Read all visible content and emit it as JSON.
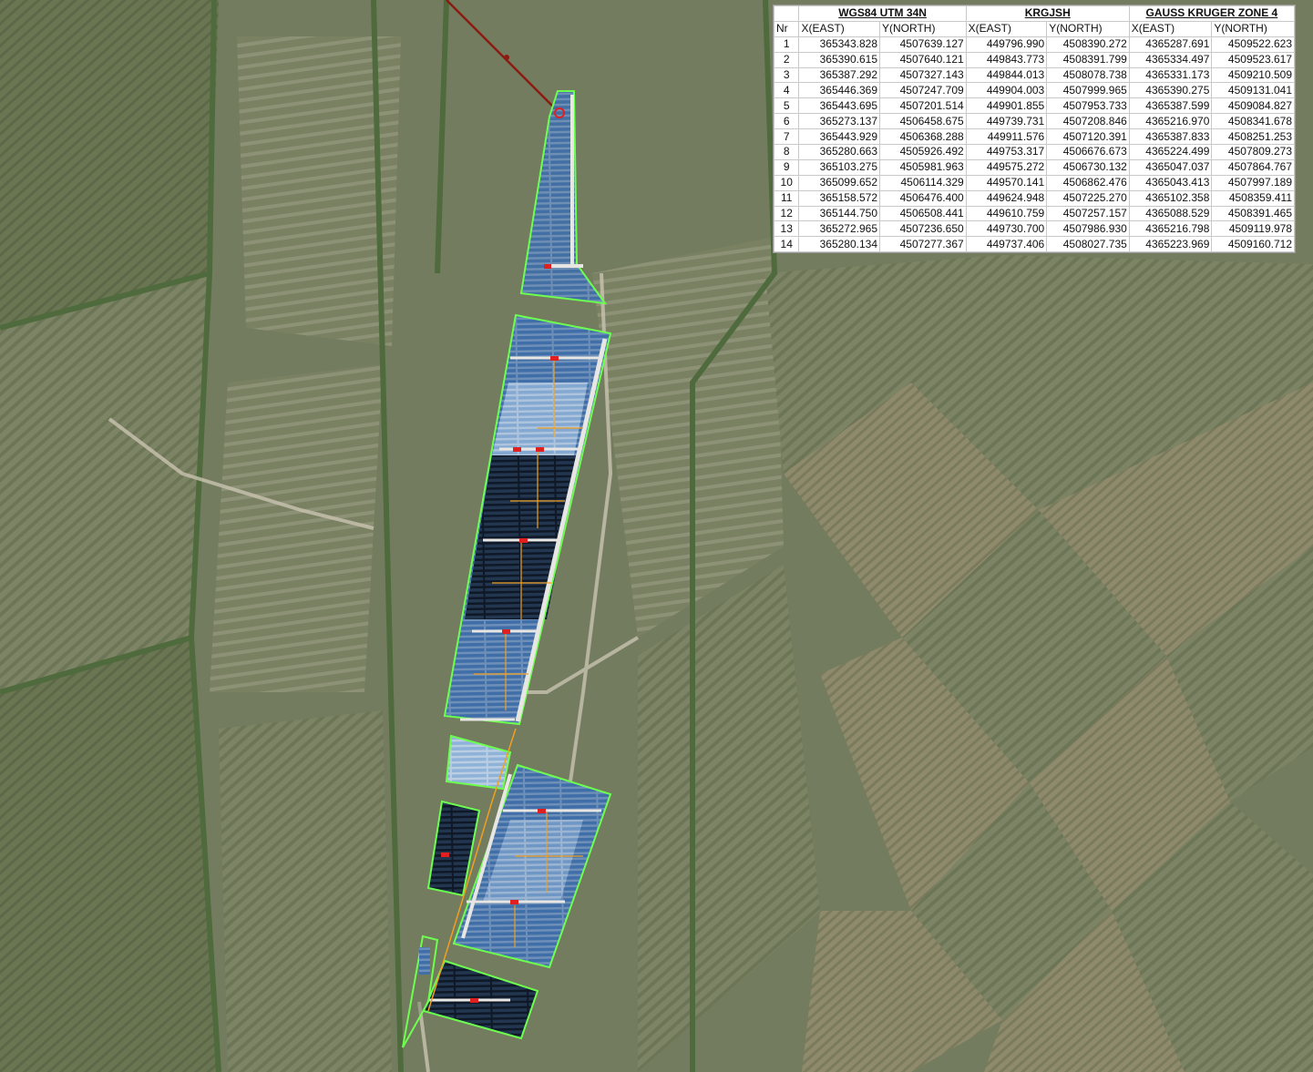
{
  "map": {
    "colors": {
      "boundary": "#6dff4f",
      "panel_light": "#8fb2d8",
      "panel_mid": "#3f6ea8",
      "panel_dark": "#1c2f4a",
      "cable": "#f0a020",
      "road": "#e8e6e2",
      "inverter": "#e02020",
      "power_line": "#8b1a10"
    }
  },
  "table": {
    "systems": [
      "WGS84 UTM 34N",
      "KRGJSH",
      "GAUSS KRUGER ZONE 4"
    ],
    "columns": [
      "Nr",
      "X(EAST)",
      "Y(NORTH)",
      "X(EAST)",
      "Y(NORTH)",
      "X(EAST)",
      "Y(NORTH)"
    ],
    "rows": [
      [
        "1",
        "365343.828",
        "4507639.127",
        "449796.990",
        "4508390.272",
        "4365287.691",
        "4509522.623"
      ],
      [
        "2",
        "365390.615",
        "4507640.121",
        "449843.773",
        "4508391.799",
        "4365334.497",
        "4509523.617"
      ],
      [
        "3",
        "365387.292",
        "4507327.143",
        "449844.013",
        "4508078.738",
        "4365331.173",
        "4509210.509"
      ],
      [
        "4",
        "365446.369",
        "4507247.709",
        "449904.003",
        "4507999.965",
        "4365390.275",
        "4509131.041"
      ],
      [
        "5",
        "365443.695",
        "4507201.514",
        "449901.855",
        "4507953.733",
        "4365387.599",
        "4509084.827"
      ],
      [
        "6",
        "365273.137",
        "4506458.675",
        "449739.731",
        "4507208.846",
        "4365216.970",
        "4508341.678"
      ],
      [
        "7",
        "365443.929",
        "4506368.288",
        "449911.576",
        "4507120.391",
        "4365387.833",
        "4508251.253"
      ],
      [
        "8",
        "365280.663",
        "4505926.492",
        "449753.317",
        "4506676.673",
        "4365224.499",
        "4507809.273"
      ],
      [
        "9",
        "365103.275",
        "4505981.963",
        "449575.272",
        "4506730.132",
        "4365047.037",
        "4507864.767"
      ],
      [
        "10",
        "365099.652",
        "4506114.329",
        "449570.141",
        "4506862.476",
        "4365043.413",
        "4507997.189"
      ],
      [
        "11",
        "365158.572",
        "4506476.400",
        "449624.948",
        "4507225.270",
        "4365102.358",
        "4508359.411"
      ],
      [
        "12",
        "365144.750",
        "4506508.441",
        "449610.759",
        "4507257.157",
        "4365088.529",
        "4508391.465"
      ],
      [
        "13",
        "365272.965",
        "4507236.650",
        "449730.700",
        "4507986.930",
        "4365216.798",
        "4509119.978"
      ],
      [
        "14",
        "365280.134",
        "4507277.367",
        "449737.406",
        "4508027.735",
        "4365223.969",
        "4509160.712"
      ]
    ]
  }
}
